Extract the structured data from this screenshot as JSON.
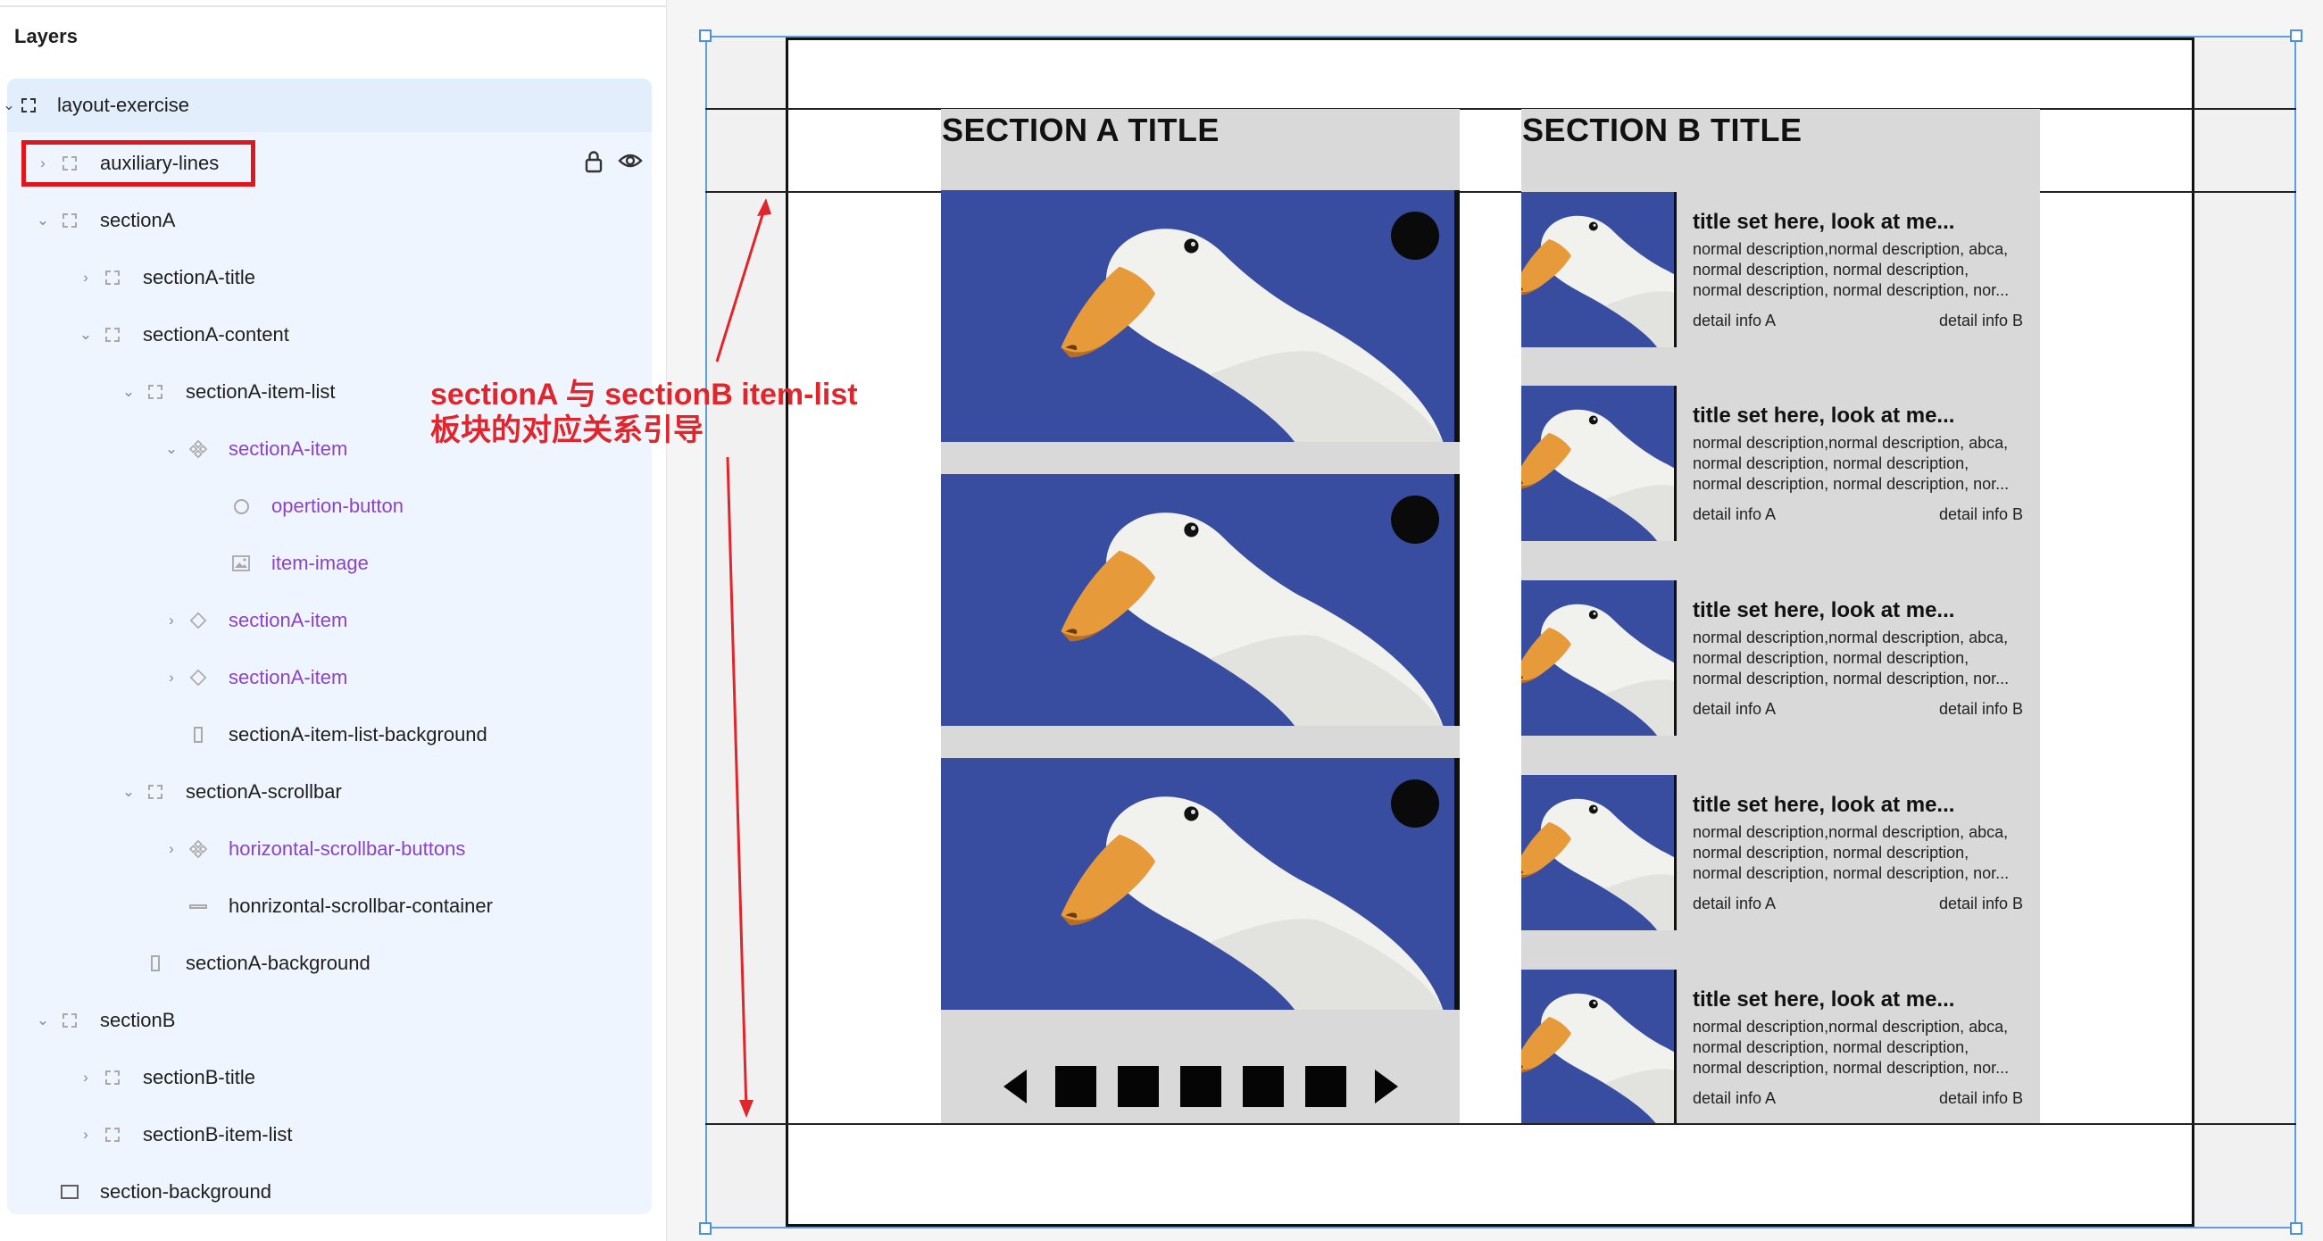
{
  "layers_panel": {
    "title": "Layers",
    "tree": [
      {
        "label": "layout-exercise",
        "icon": "frame-icon"
      },
      {
        "label": "auxiliary-lines",
        "icon": "frame-icon"
      },
      {
        "label": "sectionA",
        "icon": "frame-icon"
      },
      {
        "label": "sectionA-title",
        "icon": "frame-icon"
      },
      {
        "label": "sectionA-content",
        "icon": "frame-icon"
      },
      {
        "label": "sectionA-item-list",
        "icon": "frame-icon"
      },
      {
        "label": "sectionA-item",
        "icon": "component-icon"
      },
      {
        "label": "opertion-button",
        "icon": "ellipse-icon"
      },
      {
        "label": "item-image",
        "icon": "image-icon"
      },
      {
        "label": "sectionA-item",
        "icon": "instance-icon"
      },
      {
        "label": "sectionA-item",
        "icon": "instance-icon"
      },
      {
        "label": "sectionA-item-list-background",
        "icon": "rectangle-icon"
      },
      {
        "label": "sectionA-scrollbar",
        "icon": "frame-icon"
      },
      {
        "label": "horizontal-scrollbar-buttons",
        "icon": "component-icon"
      },
      {
        "label": "honrizontal-scrollbar-container",
        "icon": "rectangle-icon"
      },
      {
        "label": "sectionA-background",
        "icon": "rectangle-icon"
      },
      {
        "label": "sectionB",
        "icon": "frame-icon"
      },
      {
        "label": "sectionB-title",
        "icon": "frame-icon"
      },
      {
        "label": "sectionB-item-list",
        "icon": "frame-icon"
      },
      {
        "label": "section-background",
        "icon": "rectangle-icon"
      }
    ]
  },
  "canvas": {
    "sectionA_title": "SECTION A TITLE",
    "sectionB_title": "SECTION B TITLE",
    "annotation_line1": "sectionA 与 sectionB item-list",
    "annotation_line2": "板块的对应关系引导",
    "sectionB_items": [
      {
        "title": "title set here, look at me...",
        "desc1": "normal description,normal description, abca,",
        "desc2": "normal description, normal description,",
        "desc3": "normal description, normal description, nor...",
        "detail_a": "detail info A",
        "detail_b": "detail info B"
      },
      {
        "title": "title set here, look at me...",
        "desc1": "normal description,normal description, abca,",
        "desc2": "normal description, normal description,",
        "desc3": "normal description, normal description, nor...",
        "detail_a": "detail info A",
        "detail_b": "detail info B"
      },
      {
        "title": "title set here, look at me...",
        "desc1": "normal description,normal description, abca,",
        "desc2": "normal description, normal description,",
        "desc3": "normal description, normal description, nor...",
        "detail_a": "detail info A",
        "detail_b": "detail info B"
      },
      {
        "title": "title set here, look at me...",
        "desc1": "normal description,normal description, abca,",
        "desc2": "normal description, normal description,",
        "desc3": "normal description, normal description, nor...",
        "detail_a": "detail info A",
        "detail_b": "detail info B"
      },
      {
        "title": "title set here, look at me...",
        "desc1": "normal description,normal description, abca,",
        "desc2": "normal description, normal description,",
        "desc3": "normal description, normal description, nor...",
        "detail_a": "detail info A",
        "detail_b": "detail info B"
      }
    ]
  },
  "colors": {
    "selection": "#5b9fe3",
    "component_text": "#8a44c4",
    "annotation": "#e0262c",
    "section_bg": "#d9d9d9",
    "sky": "#3a4fa0"
  }
}
